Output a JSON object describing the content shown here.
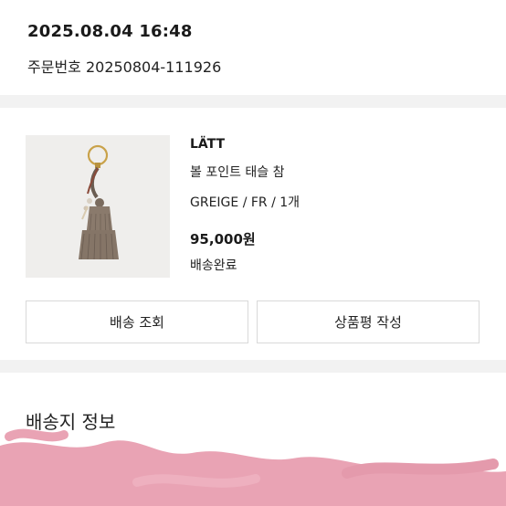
{
  "order": {
    "datetime": "2025.08.04 16:48",
    "number_label": "주문번호 20250804-111926"
  },
  "product": {
    "brand": "LÄTT",
    "name": "볼 포인트 태슬 참",
    "option": "GREIGE / FR / 1개",
    "price": "95,000원",
    "status": "배송완료",
    "image_icon": "tassel-charm-image",
    "tassel_color": "#8a7a6c"
  },
  "actions": {
    "track_label": "배송 조회",
    "review_label": "상품평 작성"
  },
  "shipping": {
    "heading": "배송지 정보"
  },
  "colors": {
    "redaction": "#e9a3b4",
    "background": "#f2f2f2"
  }
}
